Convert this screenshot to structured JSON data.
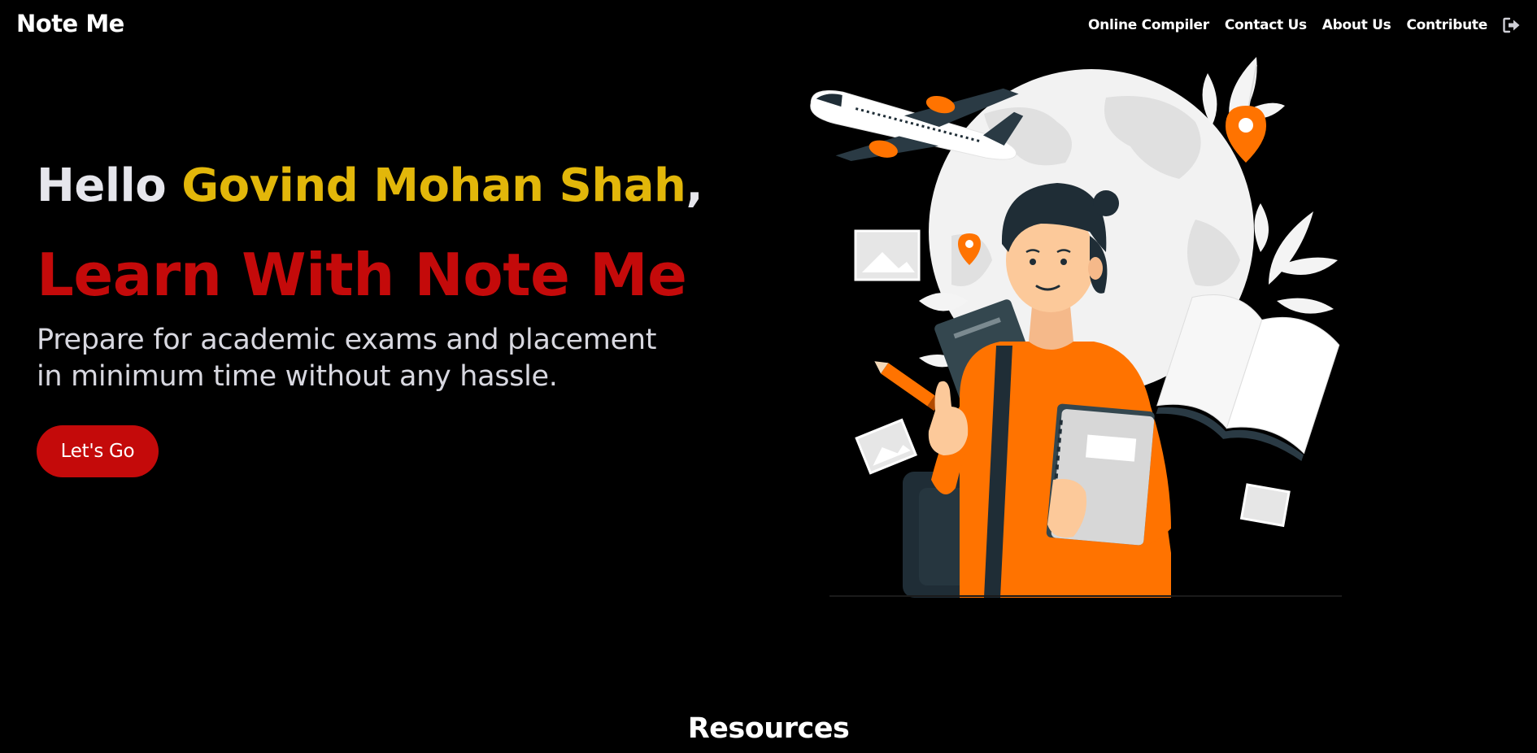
{
  "navbar": {
    "brand": "Note Me",
    "links": [
      {
        "label": "Online Compiler"
      },
      {
        "label": "Contact Us"
      },
      {
        "label": "About Us"
      },
      {
        "label": "Contribute"
      }
    ],
    "logout_icon": "sign-out-icon"
  },
  "hero": {
    "greeting_prefix": "Hello ",
    "user_name": "Govind Mohan Shah",
    "greeting_suffix": ",",
    "title": "Learn With Note Me",
    "subtitle": "Prepare for academic exams and placement in minimum time without any hassle.",
    "cta_label": "Let's Go",
    "illustration_icon": "student-traveler-illustration"
  },
  "sections": {
    "resources_heading": "Resources"
  },
  "colors": {
    "background": "#000000",
    "accent_red": "#c40a0a",
    "name_yellow": "#e2b70a",
    "illustration_orange": "#ff7300"
  }
}
